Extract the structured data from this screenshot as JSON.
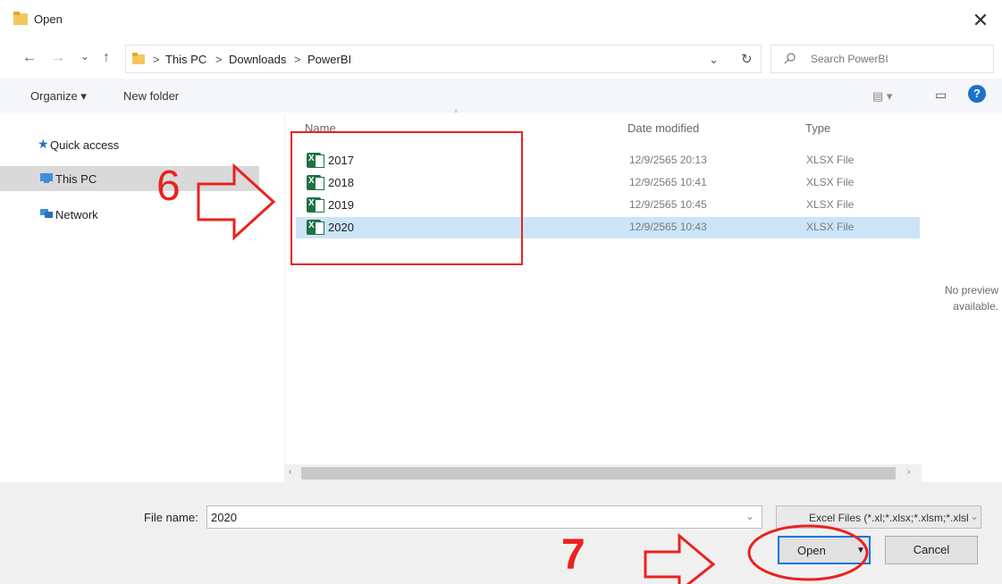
{
  "window": {
    "title": "Open",
    "close_glyph": "✕"
  },
  "nav": {
    "back_glyph": "←",
    "forward_glyph": "→",
    "recent_glyph": "⌄",
    "up_glyph": "↑",
    "breadcrumb": [
      "This PC",
      "Downloads",
      "PowerBI"
    ],
    "separator": ">",
    "dropdown_glyph": "⌄",
    "refresh_glyph": "↻"
  },
  "search": {
    "placeholder": "Search PowerBI"
  },
  "toolbar": {
    "organize_label": "Organize ▾",
    "new_folder_label": "New folder",
    "view_glyph": "▤ ▾",
    "pane_glyph": "▭",
    "help_glyph": "?"
  },
  "sidebar": {
    "items": [
      {
        "label": "Quick access",
        "icon": "star-icon"
      },
      {
        "label": "This PC",
        "icon": "computer-icon"
      },
      {
        "label": "Network",
        "icon": "network-icon"
      }
    ]
  },
  "file_list": {
    "columns": [
      "Name",
      "Date modified",
      "Type"
    ],
    "rows": [
      {
        "name": "2017",
        "date": "12/9/2565 20:13",
        "type": "XLSX File"
      },
      {
        "name": "2018",
        "date": "12/9/2565 10:41",
        "type": "XLSX File"
      },
      {
        "name": "2019",
        "date": "12/9/2565 10:45",
        "type": "XLSX File"
      },
      {
        "name": "2020",
        "date": "12/9/2565 10:43",
        "type": "XLSX File"
      }
    ]
  },
  "preview": {
    "line1": "No preview",
    "line2": "available."
  },
  "footer": {
    "file_name_label": "File name:",
    "file_name_value": "2020",
    "file_type_value": "Excel Files (*.xl;*.xlsx;*.xlsm;*.xlsb",
    "open_label": "Open",
    "cancel_label": "Cancel"
  },
  "annotations": {
    "step6": "6",
    "step7": "7"
  },
  "colors": {
    "annotation": "#e8231f",
    "selection": "#cce4f7",
    "excel": "#1e7145"
  }
}
